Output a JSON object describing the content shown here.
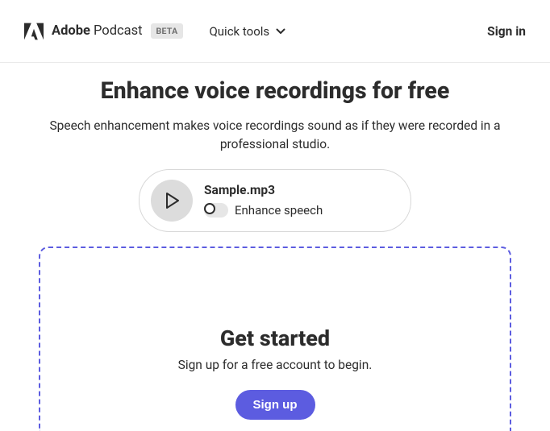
{
  "header": {
    "brand_bold": "Adobe",
    "brand_regular": "Podcast",
    "beta_badge": "BETA",
    "quick_tools_label": "Quick tools",
    "signin_label": "Sign in"
  },
  "main": {
    "title": "Enhance voice recordings for free",
    "subtitle": "Speech enhancement makes voice recordings sound as if they were recorded in a professional studio."
  },
  "player": {
    "filename": "Sample.mp3",
    "enhance_label": "Enhance speech",
    "enhance_on": false
  },
  "cta": {
    "heading": "Get started",
    "subtext": "Sign up for a free account to begin.",
    "button_label": "Sign up"
  },
  "colors": {
    "accent": "#5c5ce0"
  }
}
